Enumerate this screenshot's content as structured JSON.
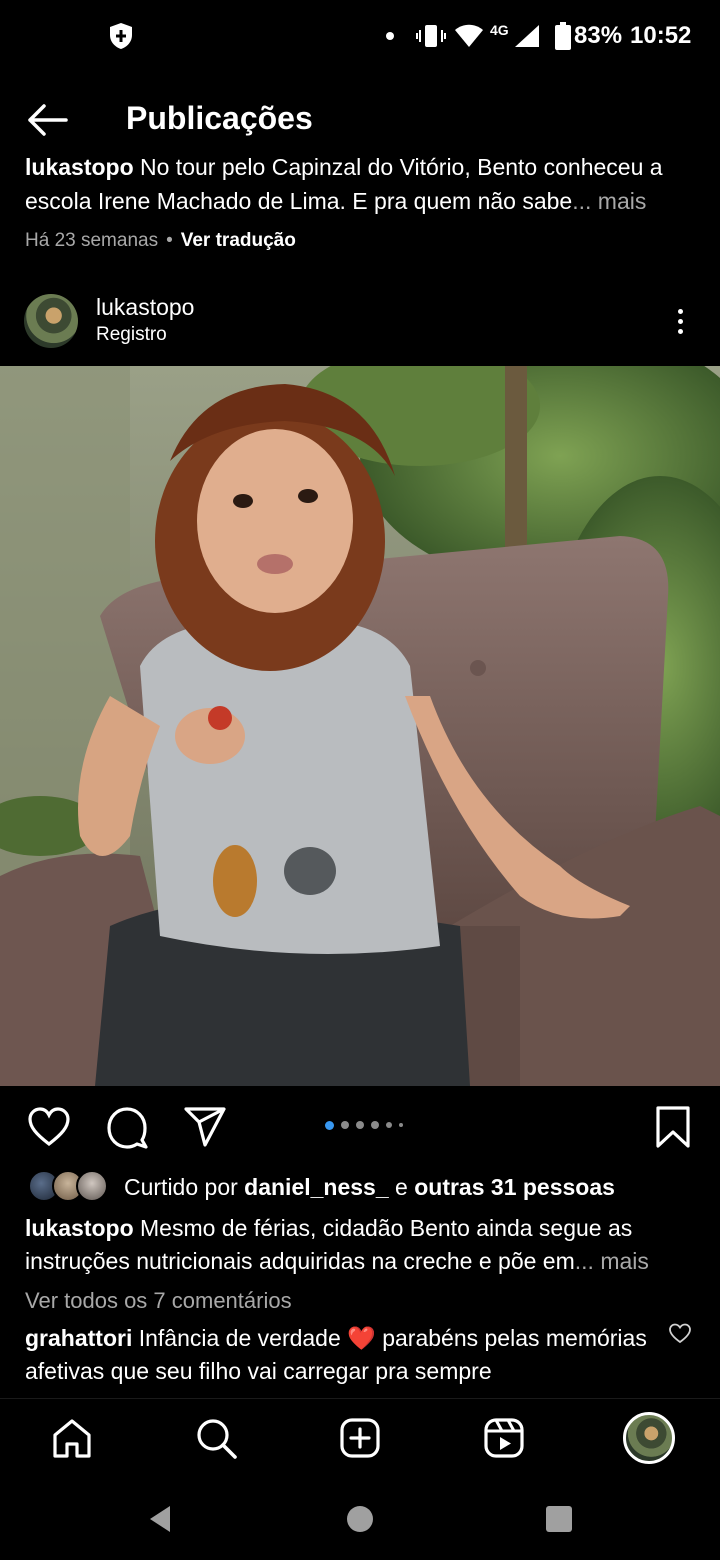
{
  "status_bar": {
    "network": "4G",
    "battery": "83%",
    "time": "10:52"
  },
  "header": {
    "title": "Publicações"
  },
  "previous_post": {
    "user": "lukastopo",
    "caption_text": " No tour pelo Capinzal do Vitório, Bento conheceu a escola Irene Machado de Lima. E pra quem não sabe",
    "more": "... mais",
    "time_ago": "Há 23 semanas",
    "separator": "•",
    "translate": "Ver tradução"
  },
  "post": {
    "username": "lukastopo",
    "location": "Registro",
    "carousel": {
      "count": 6,
      "active_index": 0
    },
    "likes": {
      "prefix": "Curtido por ",
      "user": "daniel_ness_",
      "middle": " e ",
      "others": "outras 31 pessoas"
    },
    "caption": {
      "user": "lukastopo",
      "text": " Mesmo de férias, cidadão Bento ainda segue as instruções nutricionais adquiridas na creche e põe em",
      "more": "... mais"
    },
    "view_comments": "Ver todos os 7 comentários",
    "comment": {
      "user": "grahattori",
      "text_before": " Infância de verdade ",
      "emoji": "❤️",
      "text_after": " parabéns pelas memórias afetivas que seu filho vai carregar pra sempre"
    }
  },
  "bottom_nav": {
    "items": [
      {
        "icon": "home-icon"
      },
      {
        "icon": "search-icon"
      },
      {
        "icon": "create-post-icon"
      },
      {
        "icon": "reels-icon"
      },
      {
        "icon": "profile-avatar"
      }
    ]
  },
  "colors": {
    "background": "#000000",
    "text": "#ffffff",
    "secondary_text": "#a8a8a8",
    "carousel_active": "#3897f0",
    "heart": "#e0245e"
  }
}
